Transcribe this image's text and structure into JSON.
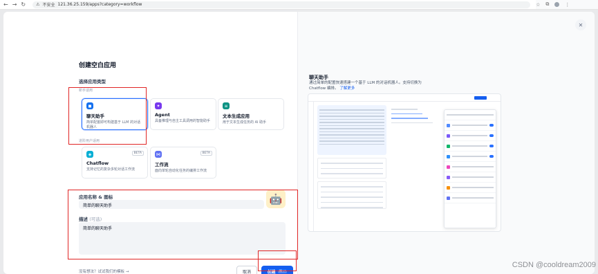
{
  "browser": {
    "security_label": "不安全",
    "url": "121.36.25.159/apps?category=workflow"
  },
  "dialog": {
    "title": "创建空白应用",
    "app_type_label": "选择应用类型",
    "beginner_group_label": "新手适用",
    "advanced_group_label": "进阶用户适用",
    "cards": [
      {
        "name": "聊天助手",
        "desc": "简单配置即可构建基于 LLM 的对话机器人",
        "selected": true,
        "icon": "chat-bubble-icon",
        "color": "#1570ef"
      },
      {
        "name": "Agent",
        "desc": "具备推理与自主工具调用的智能助手",
        "selected": false,
        "icon": "agent-icon",
        "color": "#7839ee"
      },
      {
        "name": "文本生成应用",
        "desc": "用于文本生成任务的 AI 助手",
        "selected": false,
        "icon": "text-gen-icon",
        "color": "#0e9384"
      },
      {
        "name": "Chatflow",
        "desc": "支持记忆的复杂多轮对话工作流",
        "badge": "BETA",
        "selected": false,
        "icon": "chatflow-icon",
        "color": "#06aed4"
      },
      {
        "name": "工作流",
        "desc": "面向单轮自动化任务的编排工作流",
        "badge": "BETA",
        "selected": false,
        "icon": "workflow-icon",
        "color": "#6172f3"
      }
    ],
    "name_icon_label": "应用名称 & 图标",
    "name_value": "简单的聊天助手",
    "app_icon": "robot-face-icon",
    "desc_label": "描述",
    "desc_optional": "(可选)",
    "desc_value": "简单的聊天助手",
    "no_idea_link": "没有想法？试试我们的模板 →",
    "cancel_label": "取消",
    "create_label": "创建",
    "create_shortcut": "⌘ ↵"
  },
  "preview": {
    "title": "聊天助手",
    "desc": "通过简单的配置快速搭建一个基于 LLM 的对话机器人。支持切换为 Chatflow 编排。",
    "learn_more": "了解更多"
  },
  "watermark": "CSDN @cooldream2009",
  "colors": {
    "accent": "#155eef",
    "highlight_box": "#e02424"
  }
}
